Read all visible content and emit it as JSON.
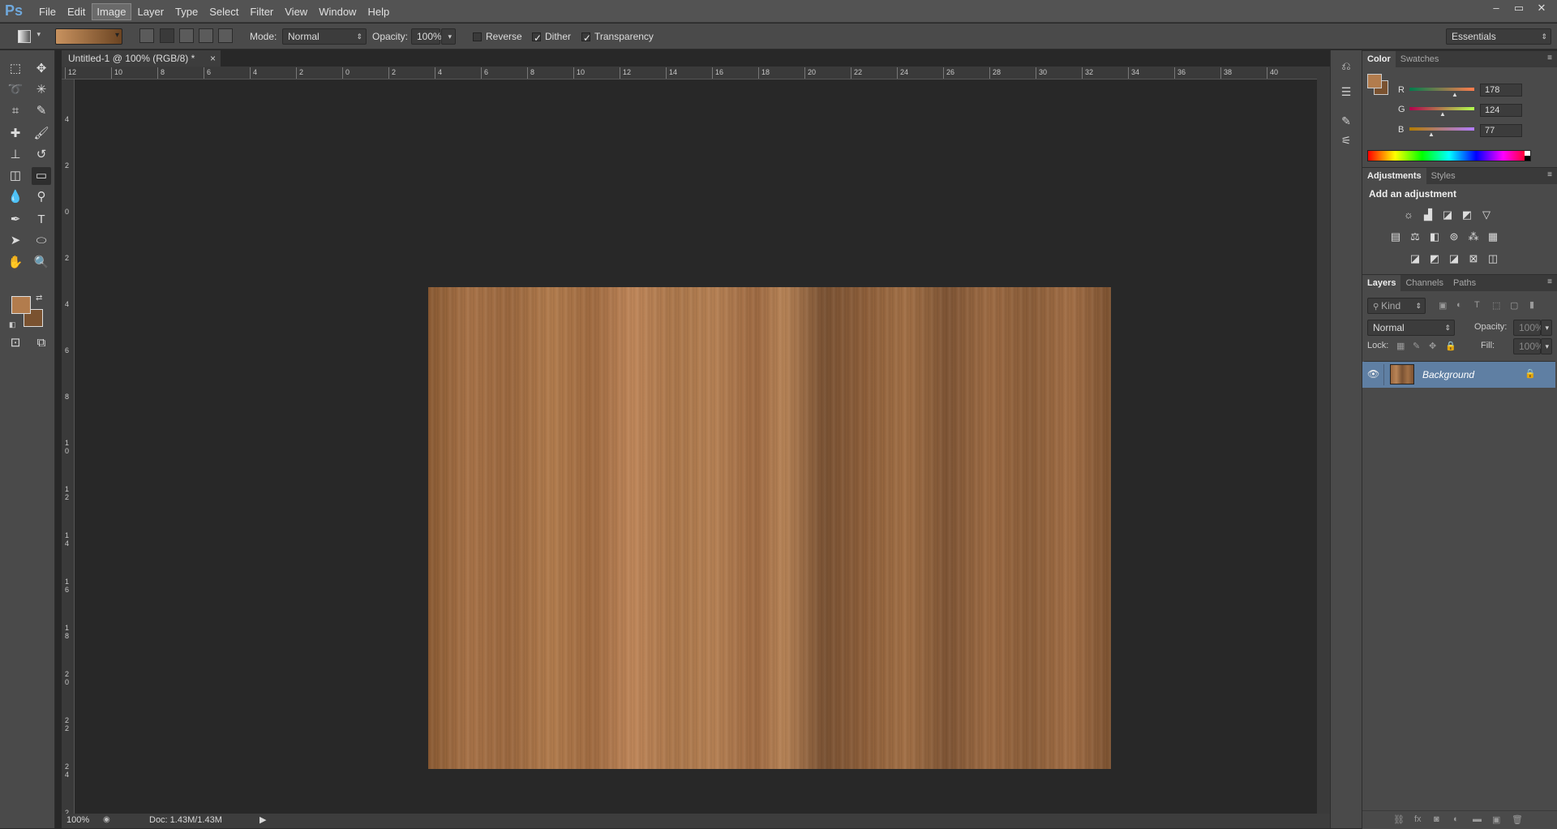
{
  "app": {
    "logo": "Ps"
  },
  "menu": [
    "File",
    "Edit",
    "Image",
    "Layer",
    "Type",
    "Select",
    "Filter",
    "View",
    "Window",
    "Help"
  ],
  "menu_active": "Image",
  "window_controls": [
    "–",
    "▭",
    "✕"
  ],
  "options": {
    "mode_label": "Mode:",
    "mode_value": "Normal",
    "opacity_label": "Opacity:",
    "opacity_value": "100%",
    "reverse_label": "Reverse",
    "reverse_checked": false,
    "dither_label": "Dither",
    "dither_checked": true,
    "transparency_label": "Transparency",
    "transparency_checked": true,
    "workspace": "Essentials"
  },
  "document": {
    "tab_title": "Untitled-1 @ 100% (RGB/8) *",
    "close": "×"
  },
  "ruler_h": [
    "12",
    "10",
    "8",
    "6",
    "4",
    "2",
    "0",
    "2",
    "4",
    "6",
    "8",
    "10",
    "12",
    "14",
    "16",
    "18",
    "20",
    "22",
    "24",
    "26",
    "28",
    "30",
    "32",
    "34",
    "36",
    "38",
    "40"
  ],
  "ruler_v": [
    "4",
    "2",
    "0",
    "2",
    "4",
    "6",
    "8",
    "10",
    "12",
    "14",
    "16",
    "18",
    "20",
    "22",
    "24",
    "2"
  ],
  "status": {
    "zoom": "100%",
    "doc": "Doc: 1.43M/1.43M"
  },
  "color_panel": {
    "tabs": [
      "Color",
      "Swatches"
    ],
    "r_label": "R",
    "r": "178",
    "g_label": "G",
    "g": "124",
    "b_label": "B",
    "b": "77",
    "foreground": "#b27c4d",
    "background": "#7a5230"
  },
  "adjustments_panel": {
    "tabs": [
      "Adjustments",
      "Styles"
    ],
    "heading": "Add an adjustment"
  },
  "layers_panel": {
    "tabs": [
      "Layers",
      "Channels",
      "Paths"
    ],
    "kind": "Kind",
    "blend": "Normal",
    "opacity_label": "Opacity:",
    "opacity": "100%",
    "lock_label": "Lock:",
    "fill_label": "Fill:",
    "fill": "100%",
    "layers": [
      {
        "name": "Background",
        "visible": true,
        "locked": true
      }
    ]
  },
  "gradient": {
    "start": "#c8925f",
    "end": "#6b4422"
  }
}
